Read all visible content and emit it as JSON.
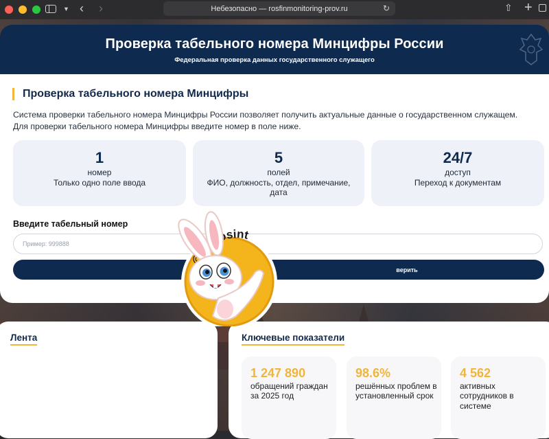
{
  "browser": {
    "address": "Небезопасно — rosfinmonitoring-prov.ru"
  },
  "hero": {
    "title": "Проверка табельного номера Минцифры России",
    "subtitle": "Федеральная проверка данных государственного служащего"
  },
  "check": {
    "section_title": "Проверка табельного номера Минцифры",
    "description_1": "Система проверки табельного номера Минцифры России позволяет получить актуальные данные о государственном служащем.",
    "description_2": "Для проверки табельного номера Минцифры введите номер в поле ниже.",
    "stats": [
      {
        "num": "1",
        "unit": "номер",
        "info": "Только одно поле ввода"
      },
      {
        "num": "5",
        "unit": "полей",
        "info": "ФИО, должность, отдел, примечание, дата"
      },
      {
        "num": "24/7",
        "unit": "доступ",
        "info": "Переход к документам"
      }
    ],
    "input_label": "Введите табельный номер",
    "input_placeholder": "Пример: 999888",
    "input_value": "",
    "submit_label": "верить"
  },
  "feed": {
    "title": "Лента"
  },
  "metrics": {
    "title": "Ключевые показатели",
    "items": [
      {
        "value": "1 247 890",
        "label": "обращений граждан за 2025 год"
      },
      {
        "value": "98.6%",
        "label": "решённых проблем в установленный срок"
      },
      {
        "value": "4 562",
        "label": "активных сотрудников в системе"
      }
    ]
  },
  "watermark": {
    "text": "@trueosint"
  },
  "colors": {
    "navy": "#0f2a4f",
    "accent": "#f0b53a",
    "stat_bg": "#eef2f8"
  },
  "icons": [
    "sidebar-icon",
    "chevron-down-icon",
    "back-arrow-icon",
    "forward-arrow-icon",
    "reload-icon",
    "share-icon",
    "new-tab-icon",
    "tabs-overview-icon",
    "emblem-icon"
  ]
}
